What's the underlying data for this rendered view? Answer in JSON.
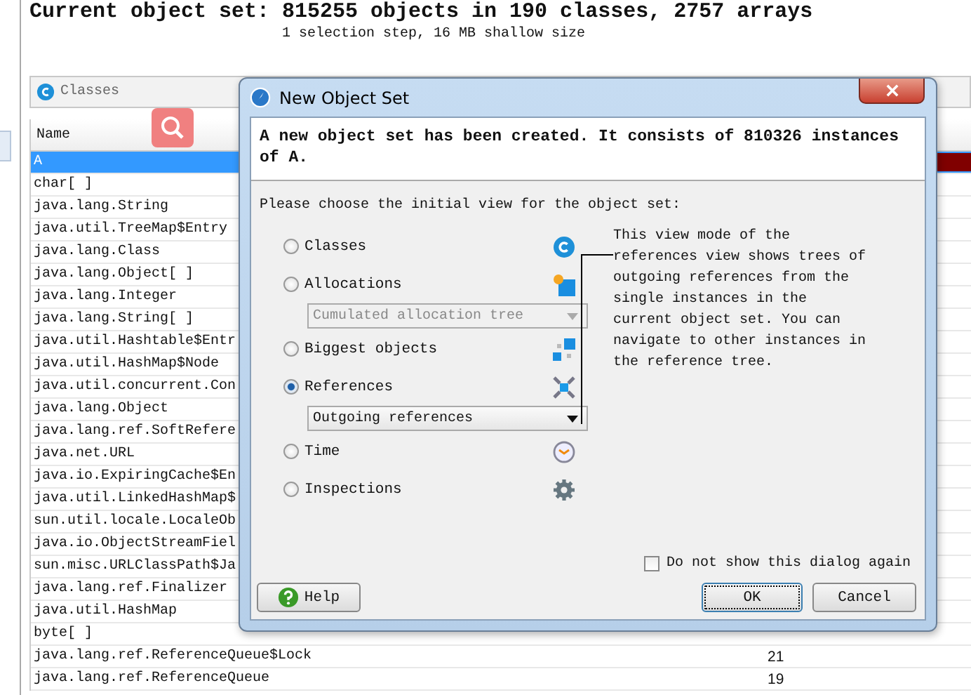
{
  "heading": "Current object set: 815255 objects in 190 classes, 2757 arrays",
  "subheading": "1 selection step, 16 MB shallow size",
  "view_tab": {
    "label": "Classes"
  },
  "table": {
    "columns": [
      "Name"
    ],
    "rows": [
      {
        "name": "A",
        "selected": true
      },
      {
        "name": "char[ ]",
        "selected": false
      },
      {
        "name": "java.lang.String",
        "selected": false
      },
      {
        "name": "java.util.TreeMap$Entry",
        "selected": false
      },
      {
        "name": "java.lang.Class",
        "selected": false
      },
      {
        "name": "java.lang.Object[ ]",
        "selected": false
      },
      {
        "name": "java.lang.Integer",
        "selected": false
      },
      {
        "name": "java.lang.String[ ]",
        "selected": false
      },
      {
        "name": "java.util.Hashtable$Entr",
        "selected": false
      },
      {
        "name": "java.util.HashMap$Node",
        "selected": false
      },
      {
        "name": "java.util.concurrent.Con",
        "selected": false
      },
      {
        "name": "java.lang.Object",
        "selected": false
      },
      {
        "name": "java.lang.ref.SoftRefere",
        "selected": false
      },
      {
        "name": "java.net.URL",
        "selected": false
      },
      {
        "name": "java.io.ExpiringCache$En",
        "selected": false
      },
      {
        "name": "java.util.LinkedHashMap$",
        "selected": false
      },
      {
        "name": "sun.util.locale.LocaleOb",
        "selected": false
      },
      {
        "name": "java.io.ObjectStreamFiel",
        "selected": false
      },
      {
        "name": "sun.misc.URLClassPath$Ja",
        "selected": false
      },
      {
        "name": "java.lang.ref.Finalizer",
        "selected": false
      },
      {
        "name": "java.util.HashMap",
        "selected": false
      },
      {
        "name": "byte[ ]",
        "selected": false
      },
      {
        "name": "java.lang.ref.ReferenceQueue$Lock",
        "count": "21",
        "selected": false
      },
      {
        "name": "java.lang.ref.ReferenceQueue",
        "count": "19",
        "selected": false
      }
    ]
  },
  "dialog": {
    "title": "New Object Set",
    "message": "A new object set has been created. It consists of 810326 instances of A.",
    "prompt": "Please choose the initial view for the object set:",
    "views": [
      {
        "label": "Classes",
        "selected": false
      },
      {
        "label": "Allocations",
        "selected": false,
        "dropdown": {
          "value": "Cumulated allocation tree",
          "disabled": true
        }
      },
      {
        "label": "Biggest objects",
        "selected": false
      },
      {
        "label": "References",
        "selected": true,
        "dropdown": {
          "value": "Outgoing references",
          "disabled": false
        }
      },
      {
        "label": "Time",
        "selected": false
      },
      {
        "label": "Inspections",
        "selected": false
      }
    ],
    "description": "This view mode of the references view shows trees of outgoing references from the single instances in the current object set. You can navigate to other instances in the reference tree.",
    "dont_show_again": {
      "label": "Do not show this dialog again",
      "checked": false
    },
    "buttons": [
      {
        "label": "Help",
        "kind": "help"
      },
      {
        "label": "OK",
        "kind": "default"
      },
      {
        "label": "Cancel",
        "kind": "plain"
      }
    ]
  }
}
